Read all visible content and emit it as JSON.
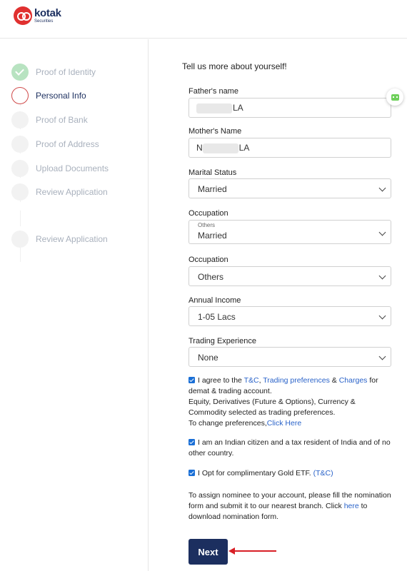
{
  "brand": {
    "name": "kotak",
    "sub": "Securities",
    "color": "#1c2f5f",
    "accent": "#e0302f"
  },
  "steps": [
    {
      "label": "Proof of Identity",
      "state": "done"
    },
    {
      "label": "Personal Info",
      "state": "active"
    },
    {
      "label": "Proof of Bank",
      "state": "pending"
    },
    {
      "label": "Proof of Address",
      "state": "pending"
    },
    {
      "label": "Upload Documents",
      "state": "pending"
    },
    {
      "label": "Review Application",
      "state": "pending"
    },
    {
      "label": "Review Application",
      "state": "pending"
    }
  ],
  "form": {
    "intro": "Tell us more about yourself!",
    "fathers_name": {
      "label": "Father's name",
      "value": "LA"
    },
    "mothers_name": {
      "label": "Mother's Name",
      "prefix": "N",
      "value": "LA"
    },
    "marital_status": {
      "label": "Marital Status",
      "value": "Married"
    },
    "occupation_1": {
      "label": "Occupation",
      "value": "Married",
      "ghost": "Others"
    },
    "occupation_2": {
      "label": "Occupation",
      "value": "Others"
    },
    "annual_income": {
      "label": "Annual Income",
      "value": "1-05 Lacs"
    },
    "trading_experience": {
      "label": "Trading Experience",
      "value": "None"
    }
  },
  "agreements": {
    "terms": {
      "part1": "I agree to the",
      "tc": "T&C",
      "comma": ",",
      "trading_prefs": "Trading preferences",
      "amp": "&",
      "charges": "Charges",
      "part2": "for demat & trading account.",
      "line2": "Equity, Derivatives (Future & Options), Currency & Commodity selected as trading preferences.",
      "line3": "To change preferences,",
      "click_here": "Click Here"
    },
    "citizen": "I am an Indian citizen and a tax resident of India and of no other country.",
    "gold": {
      "text": "I Opt for complimentary Gold ETF.",
      "tc": "(T&C)"
    }
  },
  "nominee": {
    "text1": "To assign nominee to your account, please fill the nomination form and submit it to our nearest branch. Click",
    "here": "here",
    "text2": "to download nomination form."
  },
  "buttons": {
    "next": "Next"
  },
  "colors": {
    "link": "#2a63c9",
    "checkbox": "#1a6fd6",
    "annotation_arrow": "#d81f26"
  }
}
